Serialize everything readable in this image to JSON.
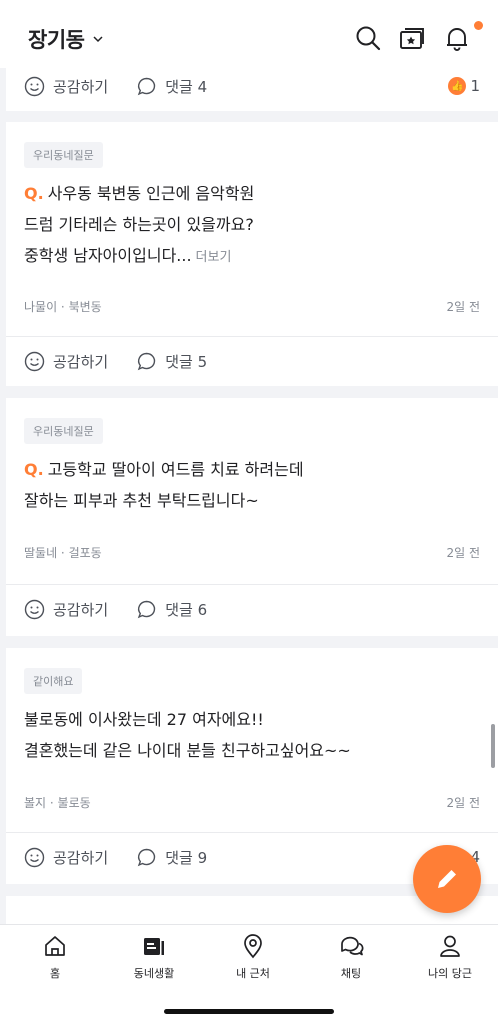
{
  "header": {
    "location": "장기동",
    "icons": [
      "chevron-down-icon",
      "search-icon",
      "category-star-icon",
      "bell-icon"
    ],
    "notification_dot_color": "#ff7e36"
  },
  "first_card": {
    "like_label": "공감하기",
    "comment_label": "댓글 4",
    "like_count": "1"
  },
  "posts": [
    {
      "tag": "우리동네질문",
      "q_mark": "Q.",
      "lines": [
        "사우동 북변동 인근에 음악학원",
        "드럼 기타레슨 하는곳이 있을까요?",
        "중학생 남자아이입니다..."
      ],
      "more": "더보기",
      "author": "나물이 · 북변동",
      "time": "2일 전",
      "like_label": "공감하기",
      "comment_label": "댓글 5"
    },
    {
      "tag": "우리동네질문",
      "q_mark": "Q.",
      "lines": [
        "고등학교 딸아이 여드름 치료 하려는데",
        "잘하는 피부과 추천 부탁드립니다~"
      ],
      "author": "딸둘네 · 걸포동",
      "time": "2일 전",
      "like_label": "공감하기",
      "comment_label": "댓글 6"
    },
    {
      "tag": "같이해요",
      "lines": [
        "불로동에 이사왔는데 27 여자에요!!",
        "결혼했는데 같은 나이대 분들 친구하고싶어요~~"
      ],
      "author": "볼지 · 불로동",
      "time": "2일 전",
      "like_label": "공감하기",
      "comment_label": "댓글 9",
      "like_count": "4"
    }
  ],
  "fab": {
    "icon": "pencil-icon",
    "color": "#ff7e36"
  },
  "nav": {
    "items": [
      {
        "label": "홈",
        "icon": "home-icon"
      },
      {
        "label": "동네생활",
        "icon": "neighborhood-life-icon"
      },
      {
        "label": "내 근처",
        "icon": "location-pin-icon"
      },
      {
        "label": "채팅",
        "icon": "chat-icon"
      },
      {
        "label": "나의 당근",
        "icon": "user-icon"
      }
    ]
  }
}
